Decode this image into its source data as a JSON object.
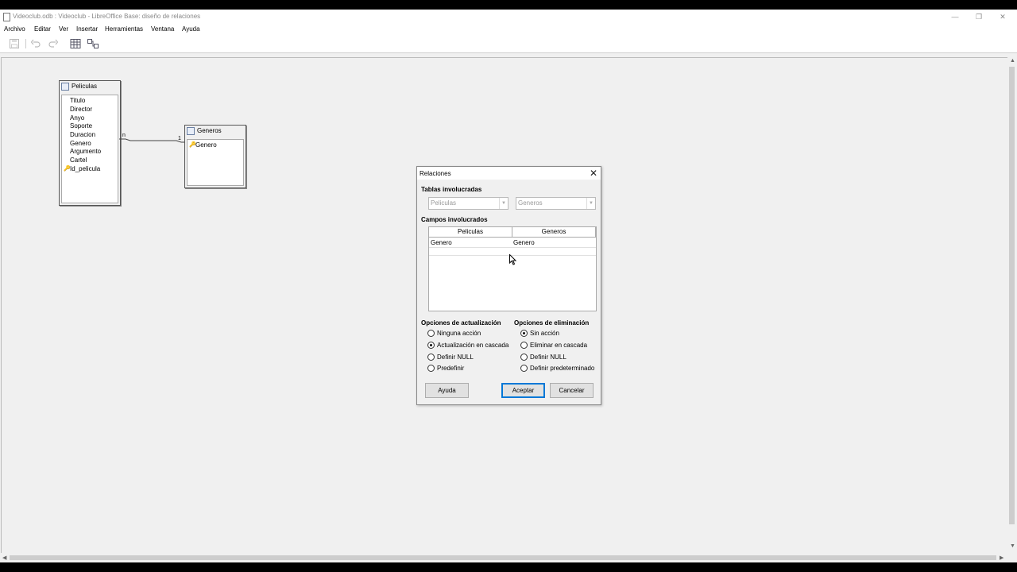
{
  "window": {
    "title": "Videoclub.odb : Videoclub - LibreOffice Base: diseño de relaciones",
    "controls": {
      "minimize": "—",
      "restore": "❐",
      "close": "✕"
    }
  },
  "menubar": {
    "items": [
      {
        "label": "Archivo"
      },
      {
        "label": "Editar"
      },
      {
        "label": "Ver"
      },
      {
        "label": "Insertar"
      },
      {
        "label": "Herramientas"
      },
      {
        "label": "Ventana"
      },
      {
        "label": "Ayuda"
      }
    ]
  },
  "toolbar": {
    "icons": [
      "save-icon",
      "undo-icon",
      "redo-icon",
      "add-table-icon",
      "new-relation-icon"
    ]
  },
  "tables": {
    "peliculas": {
      "name": "Peliculas",
      "fields": [
        "Titulo",
        "Director",
        "Anyo",
        "Soporte",
        "Duracion",
        "Genero",
        "Argumento",
        "Cartel",
        "Id_pelicula"
      ]
    },
    "generos": {
      "name": "Generos",
      "fields": [
        "Genero"
      ]
    }
  },
  "relation": {
    "from_card": "n",
    "to_card": "1"
  },
  "dialog": {
    "title": "Relaciones",
    "close": "✕",
    "tables_section": "Tablas involucradas",
    "table1": "Peliculas",
    "table2": "Generos",
    "fields_section": "Campos involucrados",
    "grid": {
      "columns": [
        "Peliculas",
        "Generos"
      ],
      "rows": [
        [
          "Genero",
          "Genero"
        ]
      ]
    },
    "update_section": "Opciones de actualización",
    "update_options": [
      "Ninguna acción",
      "Actualización en cascada",
      "Definir NULL",
      "Predefinir"
    ],
    "update_selected": 1,
    "delete_section": "Opciones de eliminación",
    "delete_options": [
      "Sin acción",
      "Eliminar en cascada",
      "Definir NULL",
      "Definir predeterminado"
    ],
    "delete_selected": 0,
    "buttons": {
      "help": "Ayuda",
      "ok": "Aceptar",
      "cancel": "Cancelar"
    }
  }
}
